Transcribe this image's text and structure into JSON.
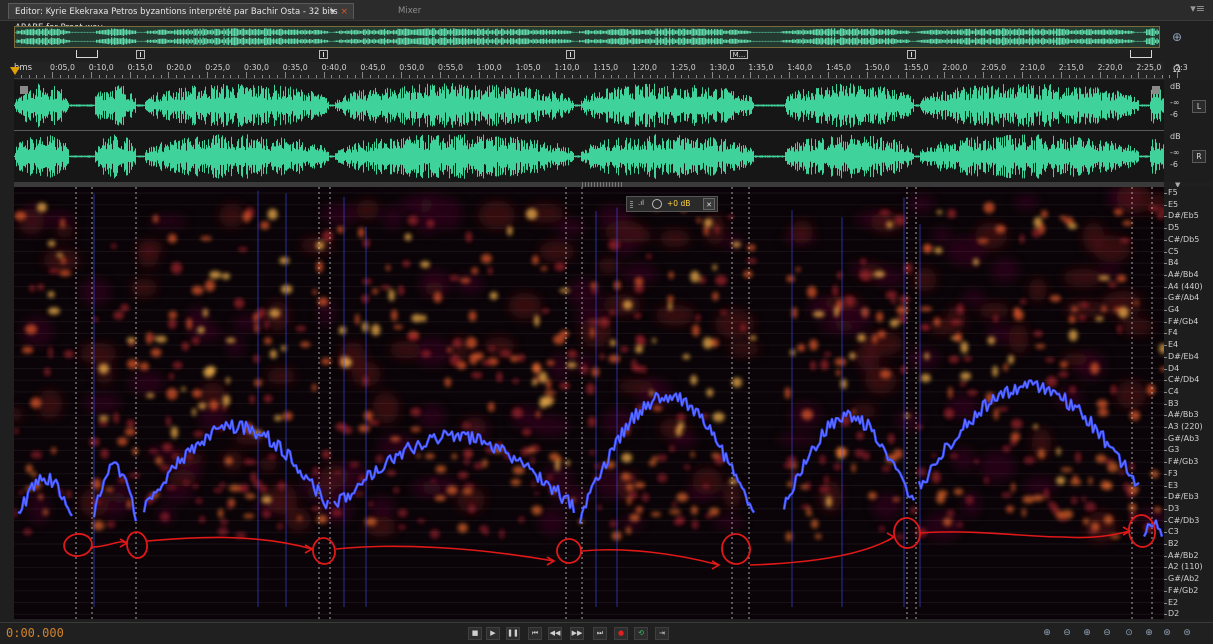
{
  "tabs": {
    "editor_label": "Editor: Kyrie Ekekraxa Petros byzantions interprété par Bachir Osta - 32 bits ARABE for Praat.wav",
    "editor_dropdown": "▾",
    "editor_close": "×",
    "mixer_label": "Mixer",
    "panel_menu": "▾≡"
  },
  "ruler": {
    "unit": "hms",
    "ticks": [
      "0:05,0",
      "0:10,0",
      "0:15,0",
      "0:20,0",
      "0:25,0",
      "0:30,0",
      "0:35,0",
      "0:40,0",
      "0:45,0",
      "0:50,0",
      "0:55,0",
      "1:00,0",
      "1:05,0",
      "1:10,0",
      "1:15,0",
      "1:20,0",
      "1:25,0",
      "1:30,0",
      "1:35,0",
      "1:40,0",
      "1:45,0",
      "1:50,0",
      "1:55,0",
      "2:00,0",
      "2:05,0",
      "2:10,0",
      "2:15,0",
      "2:20,0",
      "2:25,0",
      "2:3"
    ]
  },
  "markers": {
    "label": "M..."
  },
  "waveform": {
    "db_unit": "dB",
    "db_inf": "-∞",
    "db_6": "-6",
    "left_channel": "L",
    "right_channel": "R",
    "color": "#3fd29a"
  },
  "hud": {
    "gain": "+0 dB"
  },
  "pitch_scale": [
    "F5",
    "E5",
    "D#/Eb5",
    "D5",
    "C#/Db5",
    "C5",
    "B4",
    "A#/Bb4",
    "A4 (440)",
    "G#/Ab4",
    "G4",
    "F#/Gb4",
    "F4",
    "E4",
    "D#/Eb4",
    "D4",
    "C#/Db4",
    "C4",
    "B3",
    "A#/Bb3",
    "A3 (220)",
    "G#/Ab3",
    "G3",
    "F#/Gb3",
    "F3",
    "E3",
    "D#/Eb3",
    "D3",
    "C#/Db3",
    "C3",
    "B2",
    "A#/Bb2",
    "A2 (110)",
    "G#/Ab2",
    "F#/Gb2",
    "E2",
    "D2"
  ],
  "transport": {
    "time": "0:00.000",
    "buttons": [
      "stop-icon",
      "play-icon",
      "pause-icon",
      "go-to-start-icon",
      "rewind-icon",
      "fast-forward-icon",
      "go-to-end-icon",
      "record-icon",
      "loop-icon",
      "skip-selection-icon"
    ]
  },
  "colors": {
    "accent": "#d0822c",
    "pitch_trace": "#3a4cff",
    "annotation": "#e01818"
  }
}
